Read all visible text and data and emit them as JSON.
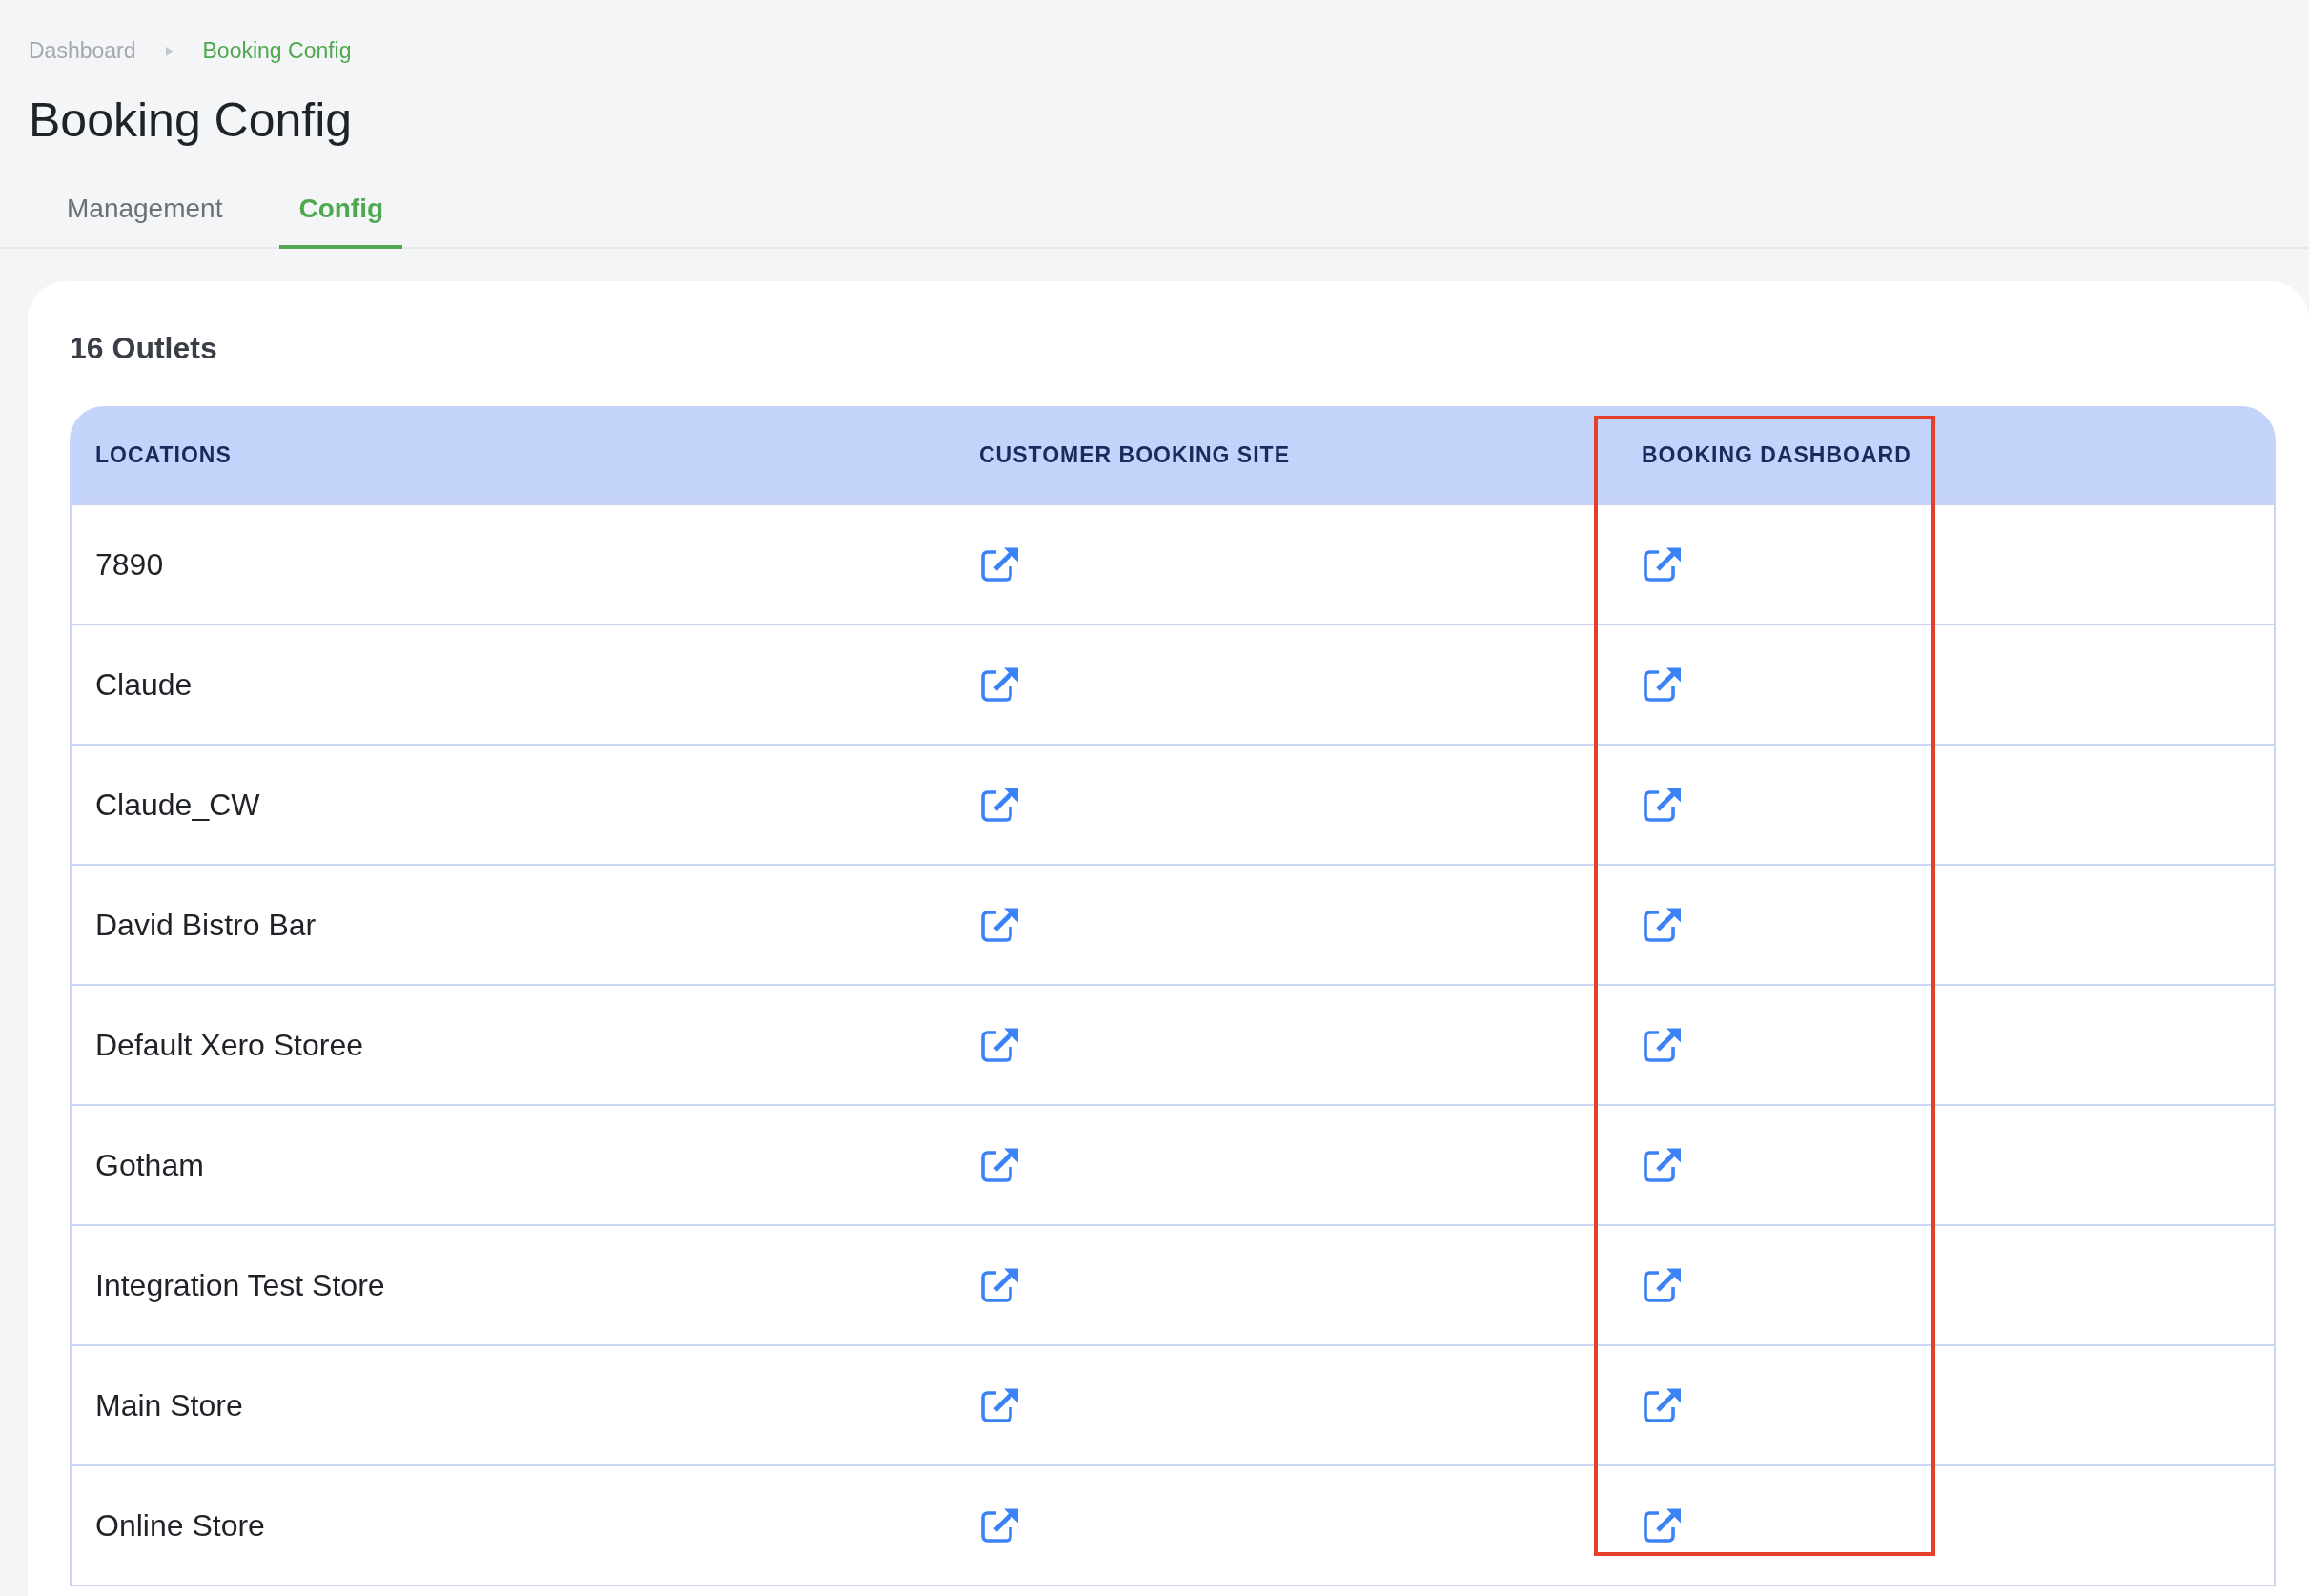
{
  "breadcrumb": [
    {
      "label": "Dashboard",
      "current": false
    },
    {
      "label": "Booking Config",
      "current": true
    }
  ],
  "title": "Booking Config",
  "tabs": [
    {
      "label": "Management",
      "selected": false
    },
    {
      "label": "Config",
      "selected": true
    }
  ],
  "outlet_count": "16 Outlets",
  "table": {
    "columns": [
      {
        "label": "LOCATIONS",
        "highlighted": false
      },
      {
        "label": "CUSTOMER BOOKING SITE",
        "highlighted": false
      },
      {
        "label": "BOOKING DASHBOARD",
        "highlighted": true
      }
    ],
    "rows": [
      {
        "location": "7890"
      },
      {
        "location": "Claude"
      },
      {
        "location": "Claude_CW"
      },
      {
        "location": "David Bistro Bar"
      },
      {
        "location": "Default Xero Storee"
      },
      {
        "location": "Gotham"
      },
      {
        "location": "Integration Test Store"
      },
      {
        "location": "Main Store"
      },
      {
        "location": "Online Store"
      }
    ]
  }
}
